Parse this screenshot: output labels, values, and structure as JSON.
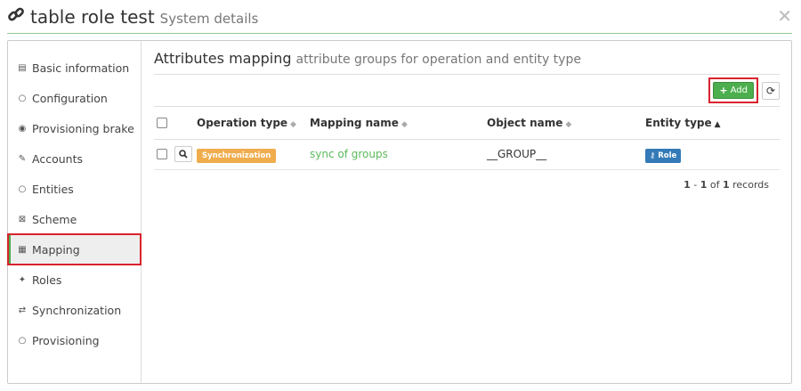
{
  "header": {
    "title": "table role test",
    "subtitle": "System details",
    "link_icon": "link-icon",
    "close_glyph": "✕"
  },
  "sidebar": {
    "items": [
      {
        "icon": "list-alt-icon",
        "glyph": "▤",
        "label": "Basic information"
      },
      {
        "icon": "circle-icon",
        "glyph": "○",
        "label": "Configuration"
      },
      {
        "icon": "record-icon",
        "glyph": "◉",
        "label": "Provisioning brake"
      },
      {
        "icon": "edit-icon",
        "glyph": "✎",
        "label": "Accounts"
      },
      {
        "icon": "circle-icon",
        "glyph": "○",
        "label": "Entities"
      },
      {
        "icon": "scheme-icon",
        "glyph": "⊠",
        "label": "Scheme"
      },
      {
        "icon": "table-icon",
        "glyph": "▦",
        "label": "Mapping",
        "active": true
      },
      {
        "icon": "wrench-icon",
        "glyph": "✦",
        "label": "Roles"
      },
      {
        "icon": "transfer-icon",
        "glyph": "⇄",
        "label": "Synchronization"
      },
      {
        "icon": "circle-icon",
        "glyph": "○",
        "label": "Provisioning"
      }
    ]
  },
  "main": {
    "title": "Attributes mapping",
    "subtitle": "attribute groups for operation and entity type",
    "add_label": "Add",
    "table": {
      "headers": [
        "Operation type",
        "Mapping name",
        "Object name",
        "Entity type"
      ],
      "rows": [
        {
          "operation_type": "Synchronization",
          "mapping_name": "sync of groups",
          "object_name": "__GROUP__",
          "entity_type": "Role"
        }
      ]
    },
    "pager": {
      "from": "1",
      "to": "1",
      "total": "1",
      "of": "of",
      "records": "records"
    }
  },
  "colors": {
    "accent": "#4cae4c",
    "highlight": "#d9232d",
    "warning": "#f0ad4e",
    "primary": "#337ab7"
  }
}
